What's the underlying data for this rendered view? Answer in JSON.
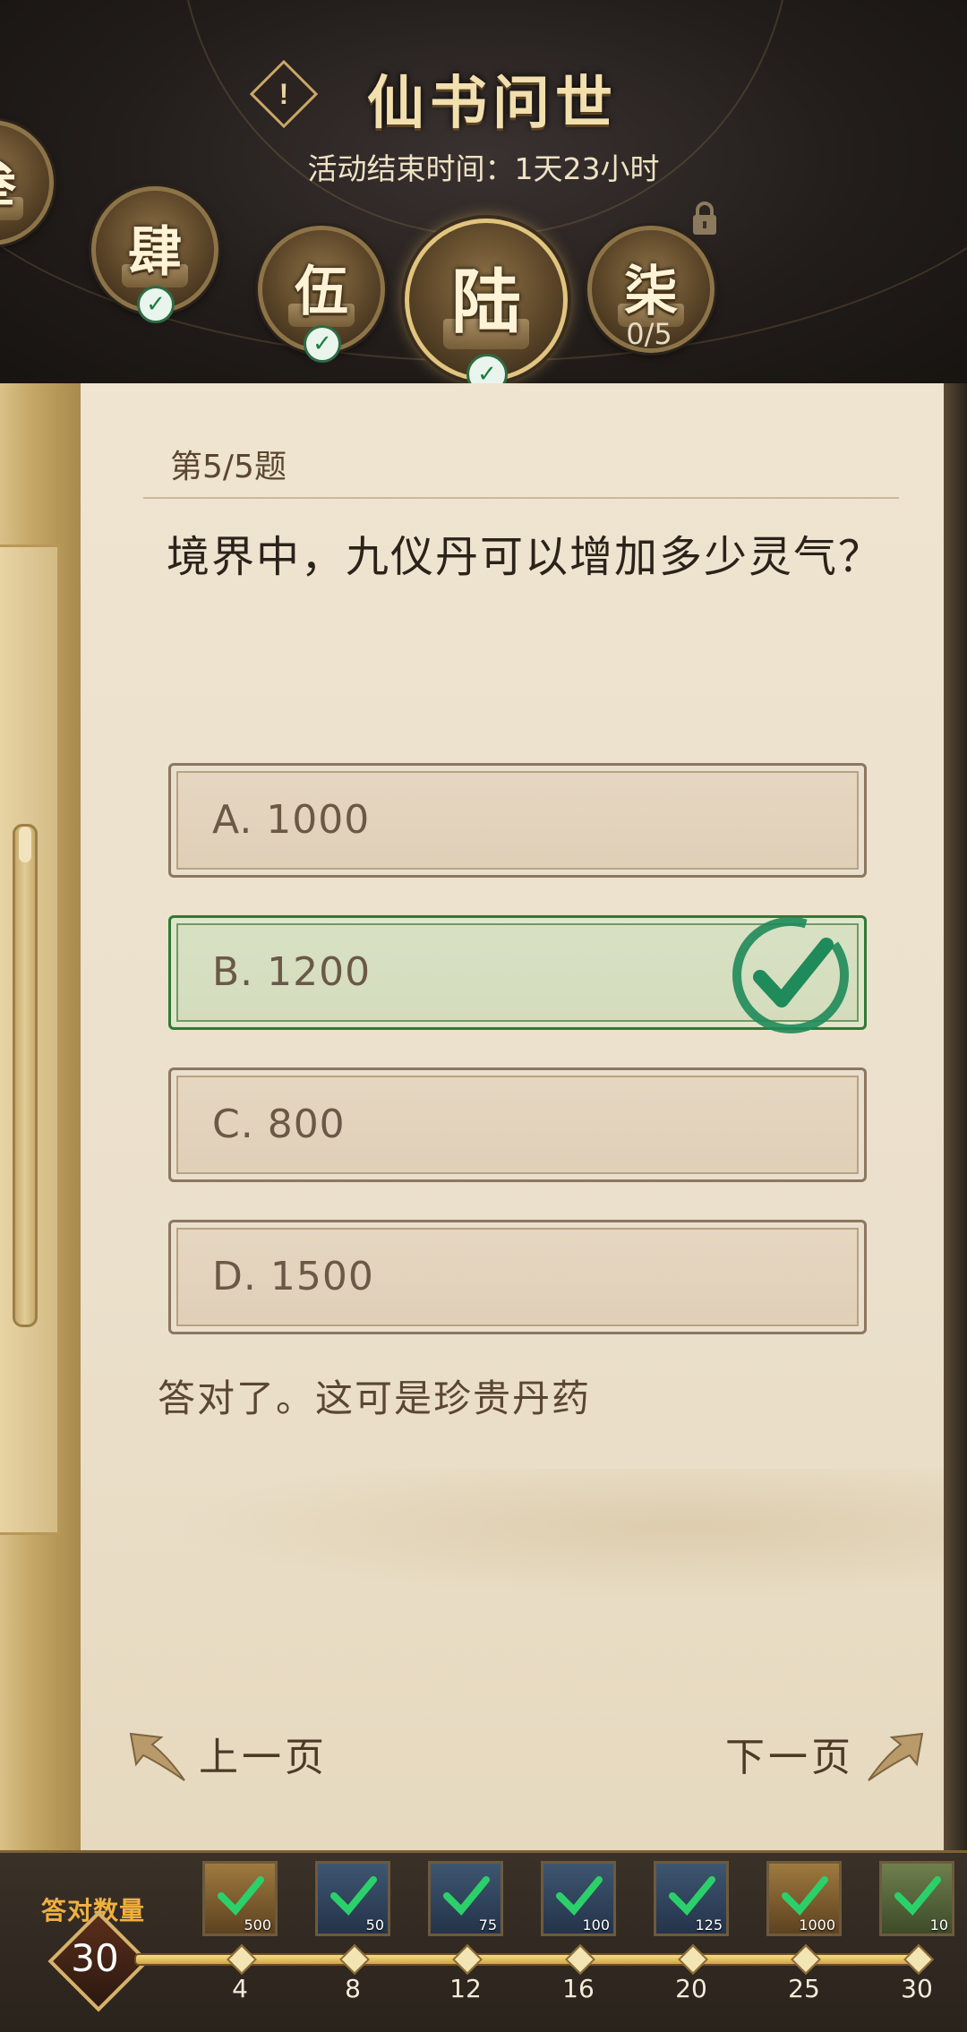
{
  "header": {
    "title": "仙书问世",
    "end_time_text": "活动结束时间：1天23小时",
    "info_icon_glyph": "!",
    "chapters": [
      {
        "id": "san",
        "label": "叁",
        "state": "completed"
      },
      {
        "id": "si",
        "label": "肆",
        "state": "completed"
      },
      {
        "id": "wu",
        "label": "伍",
        "state": "completed"
      },
      {
        "id": "liu",
        "label": "陆",
        "state": "selected-completed"
      },
      {
        "id": "qi",
        "label": "柒",
        "state": "locked",
        "progress": "0/5"
      }
    ]
  },
  "question": {
    "number_text": "第5/5题",
    "text": "境界中，九仪丹可以增加多少灵气？",
    "options": [
      {
        "text": "A. 1000",
        "correct": false
      },
      {
        "text": "B. 1200",
        "correct": true
      },
      {
        "text": "C. 800",
        "correct": false
      },
      {
        "text": "D. 1500",
        "correct": false
      }
    ],
    "feedback": "答对了。这可是珍贵丹药"
  },
  "navigation": {
    "prev_label": "上一页",
    "next_label": "下一页"
  },
  "rewards": {
    "count_label": "答对数量",
    "count_value": "30",
    "milestones": [
      "4",
      "8",
      "12",
      "16",
      "20",
      "25",
      "30"
    ],
    "items": [
      {
        "amount": "500",
        "style": "gold"
      },
      {
        "amount": "50",
        "style": "blue"
      },
      {
        "amount": "75",
        "style": "blue"
      },
      {
        "amount": "100",
        "style": "blue"
      },
      {
        "amount": "125",
        "style": "blue"
      },
      {
        "amount": "1000",
        "style": "gold"
      },
      {
        "amount": "10",
        "style": "green"
      }
    ]
  },
  "colors": {
    "correct_green": "#1f8a5a",
    "gold_accent": "#c9a866",
    "count_label_orange": "#f0b040"
  }
}
